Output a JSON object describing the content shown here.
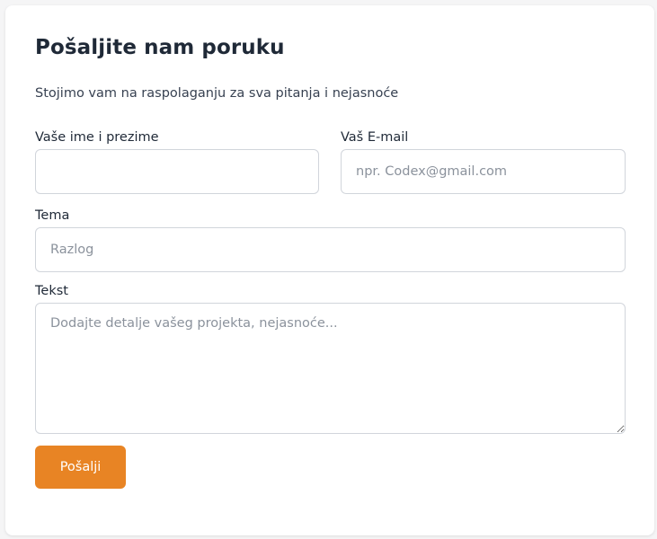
{
  "form": {
    "title": "Pošaljite nam poruku",
    "subtitle": "Stojimo vam na raspolaganju za sva pitanja i nejasnoće",
    "name": {
      "label": "Vaše ime i prezime",
      "value": "",
      "placeholder": ""
    },
    "email": {
      "label": "Vaš E-mail",
      "value": "",
      "placeholder": "npr. Codex@gmail.com"
    },
    "topic": {
      "label": "Tema",
      "value": "",
      "placeholder": "Razlog"
    },
    "message": {
      "label": "Tekst",
      "value": "",
      "placeholder": "Dodajte detalje vašeg projekta, nejasnoće..."
    },
    "submit_label": "Pošalji"
  },
  "colors": {
    "accent": "#e88424",
    "background": "#f5f5f6",
    "card": "#ffffff",
    "border": "#d1d5db"
  }
}
